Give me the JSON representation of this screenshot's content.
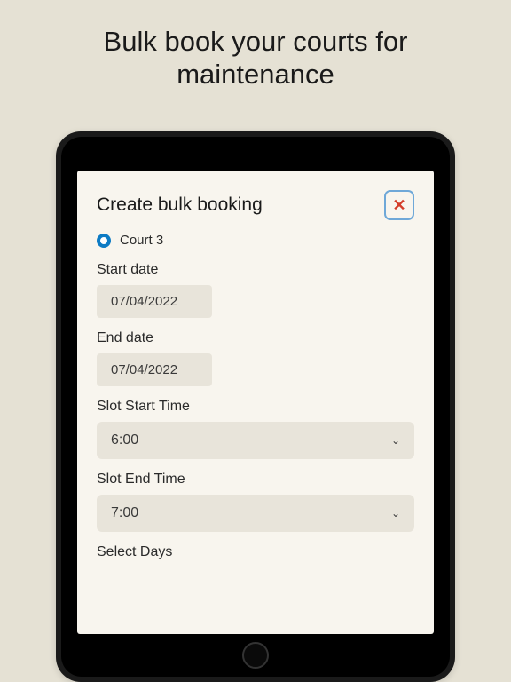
{
  "headline": "Bulk book your courts for maintenance",
  "form": {
    "title": "Create bulk booking",
    "court_label": "Court 3",
    "start_date_label": "Start date",
    "start_date_value": "07/04/2022",
    "end_date_label": "End date",
    "end_date_value": "07/04/2022",
    "slot_start_label": "Slot Start Time",
    "slot_start_value": "6:00",
    "slot_end_label": "Slot End Time",
    "slot_end_value": "7:00",
    "select_days_label": "Select Days"
  }
}
